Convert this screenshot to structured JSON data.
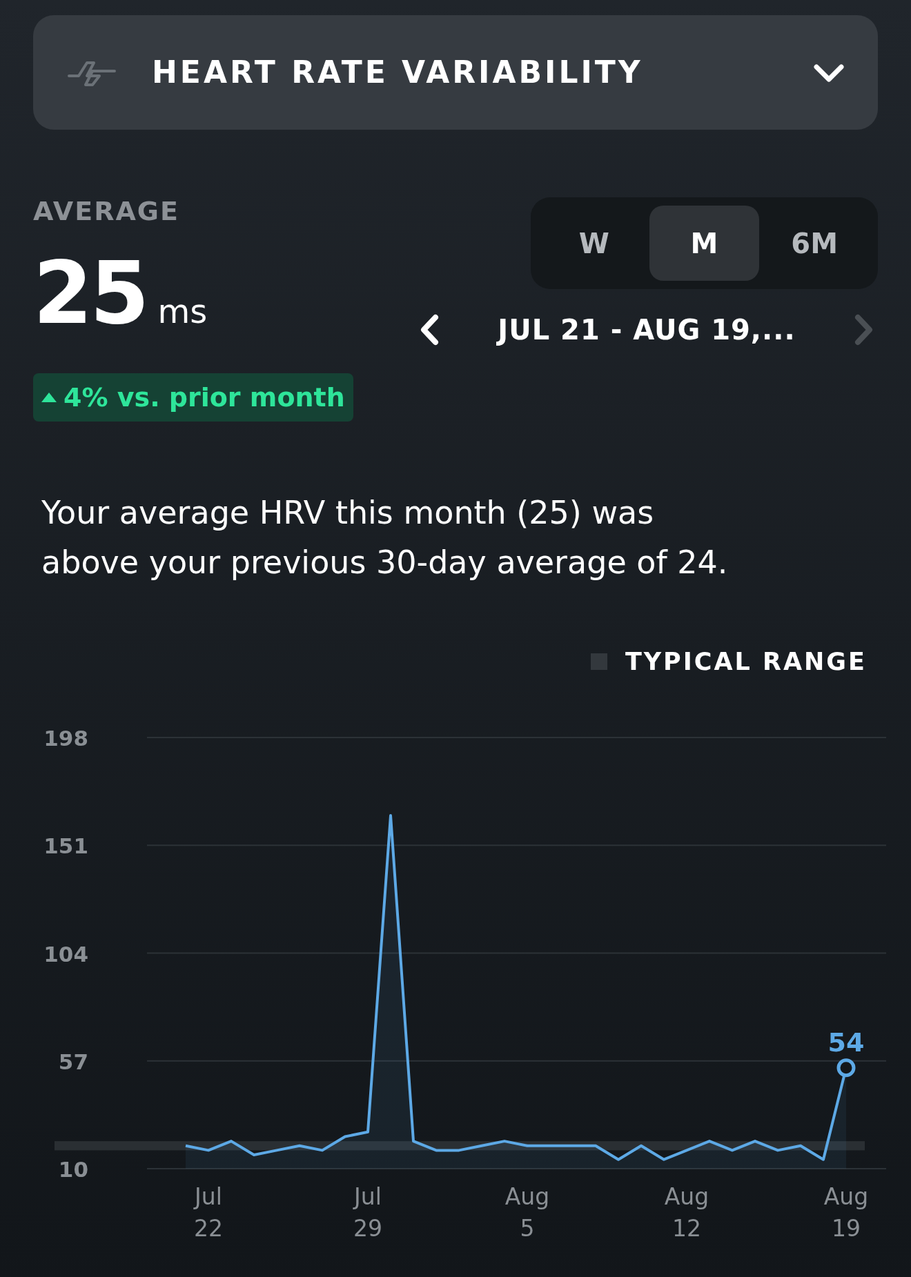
{
  "metric_selector": {
    "title": "HEART RATE VARIABILITY",
    "expanded": false
  },
  "summary": {
    "label": "AVERAGE",
    "value": "25",
    "unit": "ms",
    "change": "4% vs. prior month"
  },
  "range_tabs": [
    {
      "label": "W",
      "selected": false
    },
    {
      "label": "M",
      "selected": true
    },
    {
      "label": "6M",
      "selected": false
    }
  ],
  "date_nav": {
    "text": "JUL 21 - AUG 19,...",
    "prev_disabled": false,
    "next_disabled": true
  },
  "description": "Your average HRV this month (25) was above your previous 30-day average of 24.",
  "legend": {
    "label": "TYPICAL RANGE"
  },
  "chart": {
    "chart_data": {
      "type": "area",
      "grid": true,
      "ylim": [
        10,
        198
      ],
      "yticks": [
        10,
        57,
        104,
        151,
        198
      ],
      "categories": [
        null,
        "Jul 22",
        null,
        null,
        null,
        null,
        null,
        null,
        "Jul 29",
        null,
        null,
        null,
        null,
        null,
        null,
        "Aug 5",
        null,
        null,
        null,
        null,
        null,
        null,
        "Aug 12",
        null,
        null,
        null,
        null,
        null,
        null,
        "Aug 19"
      ],
      "series": [
        {
          "color": "#5da9e6",
          "values": [
            20,
            18,
            22,
            16,
            18,
            20,
            18,
            24,
            26,
            164,
            22,
            18,
            18,
            20,
            22,
            20,
            20,
            20,
            20,
            14,
            20,
            14,
            18,
            22,
            18,
            22,
            18,
            20,
            14,
            54
          ]
        }
      ],
      "bands": [
        {
          "axis": "y",
          "from": 18,
          "to": 22
        }
      ],
      "annotations": [
        {
          "x": "Aug 19",
          "y": 54,
          "text": "54"
        }
      ]
    }
  }
}
